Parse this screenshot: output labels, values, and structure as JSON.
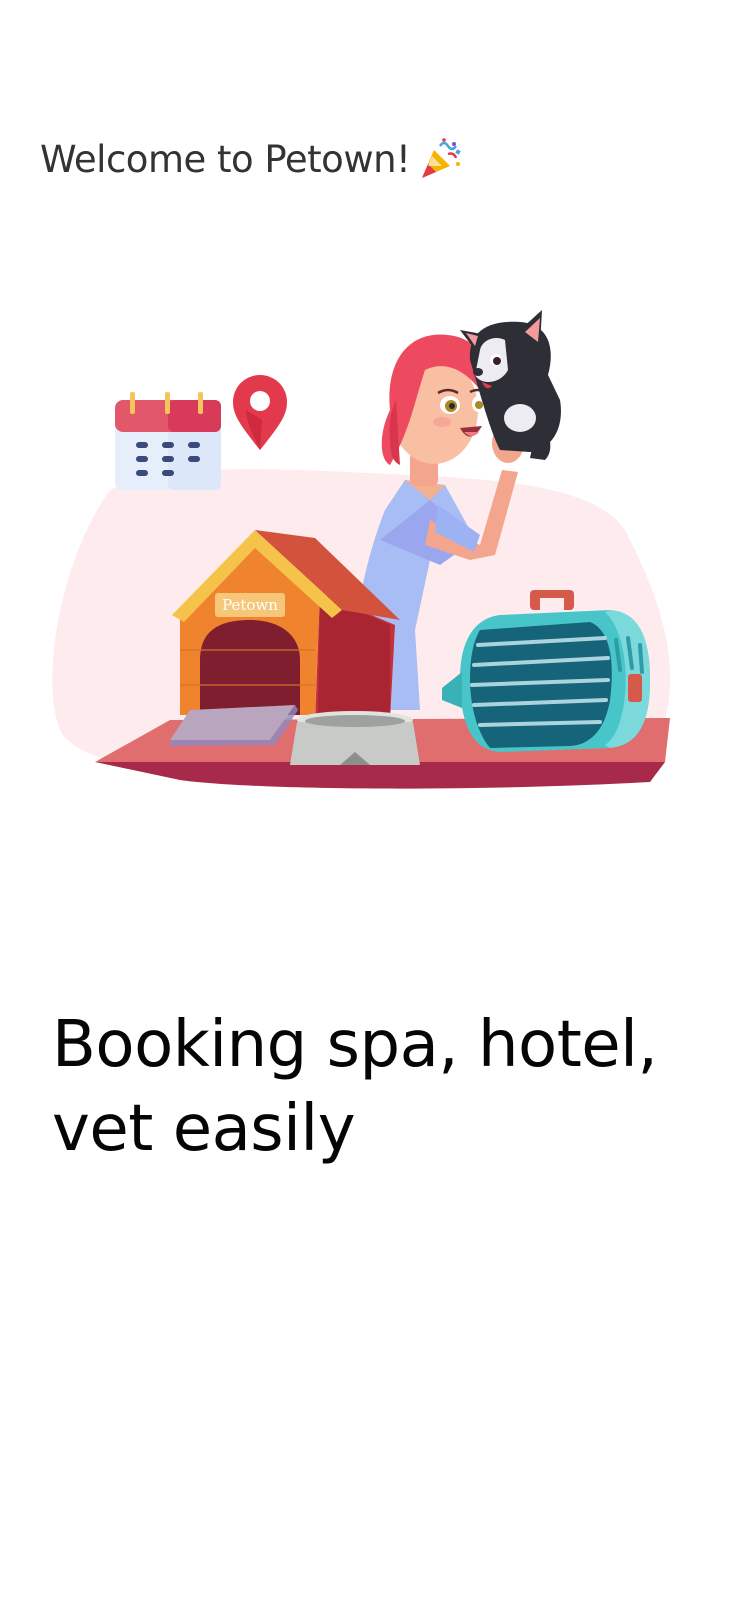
{
  "header": {
    "welcome_text": "Welcome to Petown!",
    "party_icon": "party-popper-icon"
  },
  "illustration": {
    "house_sign": "Petown",
    "icons": [
      "calendar-icon",
      "location-pin-icon",
      "puppy",
      "dog-house",
      "pet-bowl",
      "pet-carrier"
    ]
  },
  "onboarding": {
    "headline": "Booking spa, hotel, vet easily"
  },
  "colors": {
    "text_primary": "#050505",
    "text_secondary": "#333333",
    "accent_red": "#E2394C",
    "background": "#FFFFFF"
  }
}
